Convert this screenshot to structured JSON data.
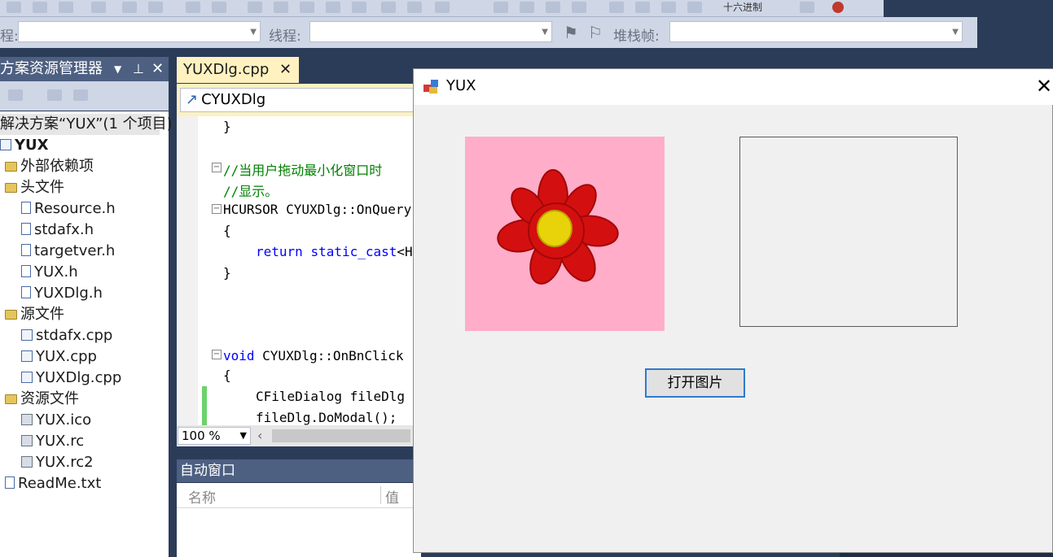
{
  "toolbar": {
    "label_left": "程:",
    "label_thread": "线程:",
    "label_stack": "堆栈帧:",
    "hex_label": "十六进制"
  },
  "solution_explorer": {
    "title": "方案资源管理器",
    "solution_label": "解决方案“YUX”(1 个项目)",
    "project": "YUX",
    "items": [
      {
        "label": "外部依赖项",
        "icon": "folder-icon",
        "indent": 1
      },
      {
        "label": "头文件",
        "icon": "folder-icon",
        "indent": 1
      },
      {
        "label": "Resource.h",
        "icon": "header-file-icon",
        "indent": 2
      },
      {
        "label": "stdafx.h",
        "icon": "header-file-icon",
        "indent": 2
      },
      {
        "label": "targetver.h",
        "icon": "header-file-icon",
        "indent": 2
      },
      {
        "label": "YUX.h",
        "icon": "header-file-icon",
        "indent": 2
      },
      {
        "label": "YUXDlg.h",
        "icon": "header-file-icon",
        "indent": 2
      },
      {
        "label": "源文件",
        "icon": "folder-icon",
        "indent": 1
      },
      {
        "label": "stdafx.cpp",
        "icon": "cpp-file-icon",
        "indent": 2
      },
      {
        "label": "YUX.cpp",
        "icon": "cpp-file-icon",
        "indent": 2
      },
      {
        "label": "YUXDlg.cpp",
        "icon": "cpp-file-icon",
        "indent": 2
      },
      {
        "label": "资源文件",
        "icon": "folder-icon",
        "indent": 1
      },
      {
        "label": "YUX.ico",
        "icon": "resource-file-icon",
        "indent": 2
      },
      {
        "label": "YUX.rc",
        "icon": "resource-file-icon",
        "indent": 2
      },
      {
        "label": "YUX.rc2",
        "icon": "resource-file-icon",
        "indent": 2
      },
      {
        "label": "ReadMe.txt",
        "icon": "text-file-icon",
        "indent": 0
      }
    ]
  },
  "editor": {
    "tab_label": "YUXDlg.cpp",
    "class_nav": "CYUXDlg",
    "zoom": "100 %",
    "lines": {
      "l1": "}",
      "l2": "//当用户拖动最小化窗口时",
      "l3": "//显示。",
      "l4_kw": "HCURSOR",
      "l4_rest": " CYUXDlg::OnQuery",
      "l5": "{",
      "l6_kw": "return",
      "l6_kw2": "static_cast",
      "l6_rest": "<H",
      "l7": "}",
      "l8_kw": "void",
      "l8_rest": " CYUXDlg::OnBnClick",
      "l9": "{",
      "l10": "CFileDialog fileDlg",
      "l11": "fileDlg.DoModal();"
    }
  },
  "auto_window": {
    "title": "自动窗口",
    "col_name": "名称",
    "col_value": "值"
  },
  "dialog": {
    "title": "YUX",
    "open_button": "打开图片"
  }
}
